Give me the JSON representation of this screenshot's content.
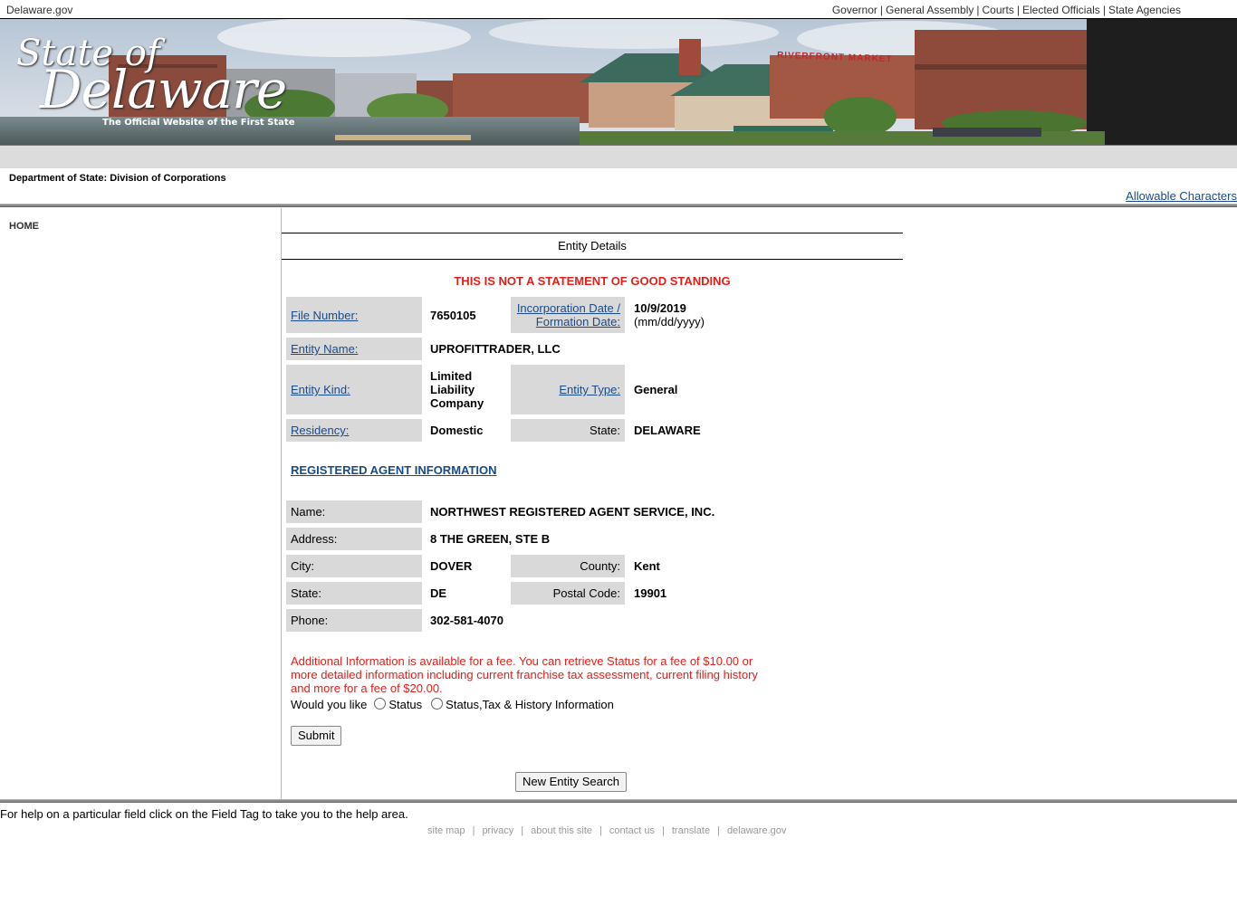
{
  "topbar": {
    "site": "Delaware.gov",
    "links": [
      "Governor",
      "General Assembly",
      "Courts",
      "Elected Officials",
      "State Agencies"
    ]
  },
  "banner": {
    "brand_line1": "State of",
    "brand_line2": "Delaware",
    "tagline": "The Official Website of the First State",
    "sign": "RIVERFRONT MARKET"
  },
  "header": {
    "department": "Department of State: Division of Corporations",
    "allowable": "Allowable Characters"
  },
  "sidebar": {
    "home": "HOME"
  },
  "entity": {
    "section_title": "Entity Details",
    "warning": "THIS IS NOT A STATEMENT OF GOOD STANDING",
    "file_number_label": "File Number:",
    "file_number": "7650105",
    "inc_date_label_1": "Incorporation Date /",
    "inc_date_label_2": "Formation Date:",
    "inc_date": "10/9/2019",
    "inc_date_format": "(mm/dd/yyyy)",
    "name_label": "Entity Name:",
    "name": "UPROFITTRADER, LLC",
    "kind_label": "Entity Kind:",
    "kind_1": "Limited",
    "kind_2": "Liability",
    "kind_3": "Company",
    "type_label": "Entity Type:",
    "type": "General",
    "residency_label": "Residency:",
    "residency": "Domestic",
    "state_label": "State:",
    "state": "DELAWARE"
  },
  "agent": {
    "heading": "REGISTERED AGENT INFORMATION",
    "name_label": "Name:",
    "name": "NORTHWEST REGISTERED AGENT SERVICE, INC.",
    "address_label": "Address:",
    "address": "8 THE GREEN, STE B",
    "city_label": "City:",
    "city": "DOVER",
    "county_label": "County:",
    "county": "Kent",
    "state_label": "State:",
    "state": "DE",
    "postal_label": "Postal Code:",
    "postal": "19901",
    "phone_label": "Phone:",
    "phone": "302-581-4070"
  },
  "additional": {
    "text": "Additional Information is available for a fee. You can retrieve Status for a fee of $10.00 or more detailed information including current franchise tax assessment, current filing history and more for a fee of $20.00.",
    "prompt": "Would you like",
    "option_status": "Status",
    "option_full": "Status,Tax & History Information",
    "submit": "Submit",
    "new_search": "New Entity Search"
  },
  "footer": {
    "help": "For help on a particular field click on the Field Tag to take you to the help area.",
    "links": [
      "site map",
      "privacy",
      "about this site",
      "contact us",
      "translate",
      "delaware.gov"
    ]
  }
}
